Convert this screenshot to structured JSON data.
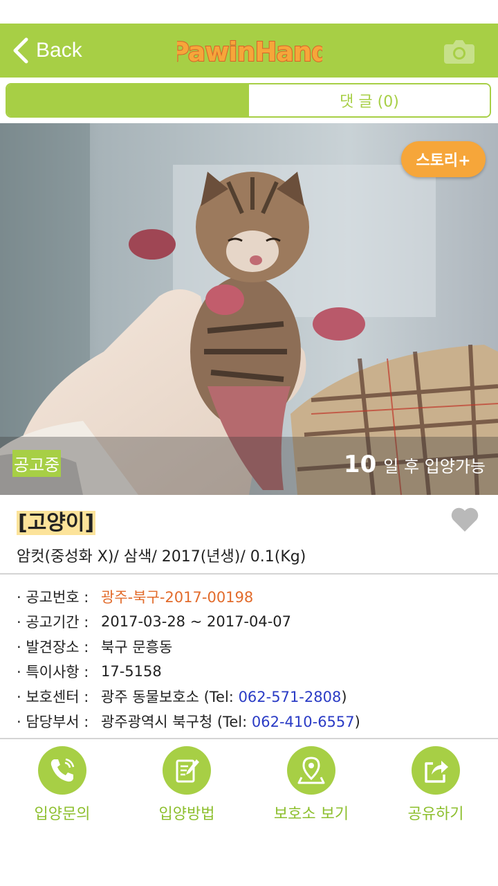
{
  "nav": {
    "back_label": "Back",
    "logo_text": "PawinHand",
    "camera_icon": "camera-icon"
  },
  "tabs": {
    "left_label": "",
    "right_label": "댓 글 (0)"
  },
  "photo": {
    "story_button": "스토리+",
    "status_tag": "공고중",
    "days_number": "10",
    "days_text": "일 후 입양가능"
  },
  "animal": {
    "title": "[고양이]",
    "summary": "암컷(중성화 X)/ 삼색/ 2017(년생)/ 0.1(Kg)"
  },
  "info": {
    "notice_no_label": "· 공고번호 :",
    "notice_no": "광주-북구-2017-00198",
    "period_label": "· 공고기간 :",
    "period": "2017-03-28 ~ 2017-04-07",
    "found_label": "· 발견장소 :",
    "found": "북구 문흥동",
    "special_label": "· 특이사항 :",
    "special": "17-5158",
    "center_label": "· 보호센터 :",
    "center_name": "광주 동물보호소 (Tel: ",
    "center_tel": "062-571-2808",
    "center_close": ")",
    "dept_label": "· 담당부서 :",
    "dept_name": "광주광역시 북구청 (Tel: ",
    "dept_tel": "062-410-6557",
    "dept_close": ")"
  },
  "actions": [
    {
      "label": "입양문의",
      "icon": "phone-icon"
    },
    {
      "label": "입양방법",
      "icon": "memo-edit-icon"
    },
    {
      "label": "보호소 보기",
      "icon": "map-pin-icon"
    },
    {
      "label": "공유하기",
      "icon": "share-icon"
    }
  ],
  "colors": {
    "brand_green": "#a7cf45",
    "accent_orange": "#f6a63a",
    "link_blue": "#2a3bc5",
    "notice_orange": "#e26b2b"
  }
}
